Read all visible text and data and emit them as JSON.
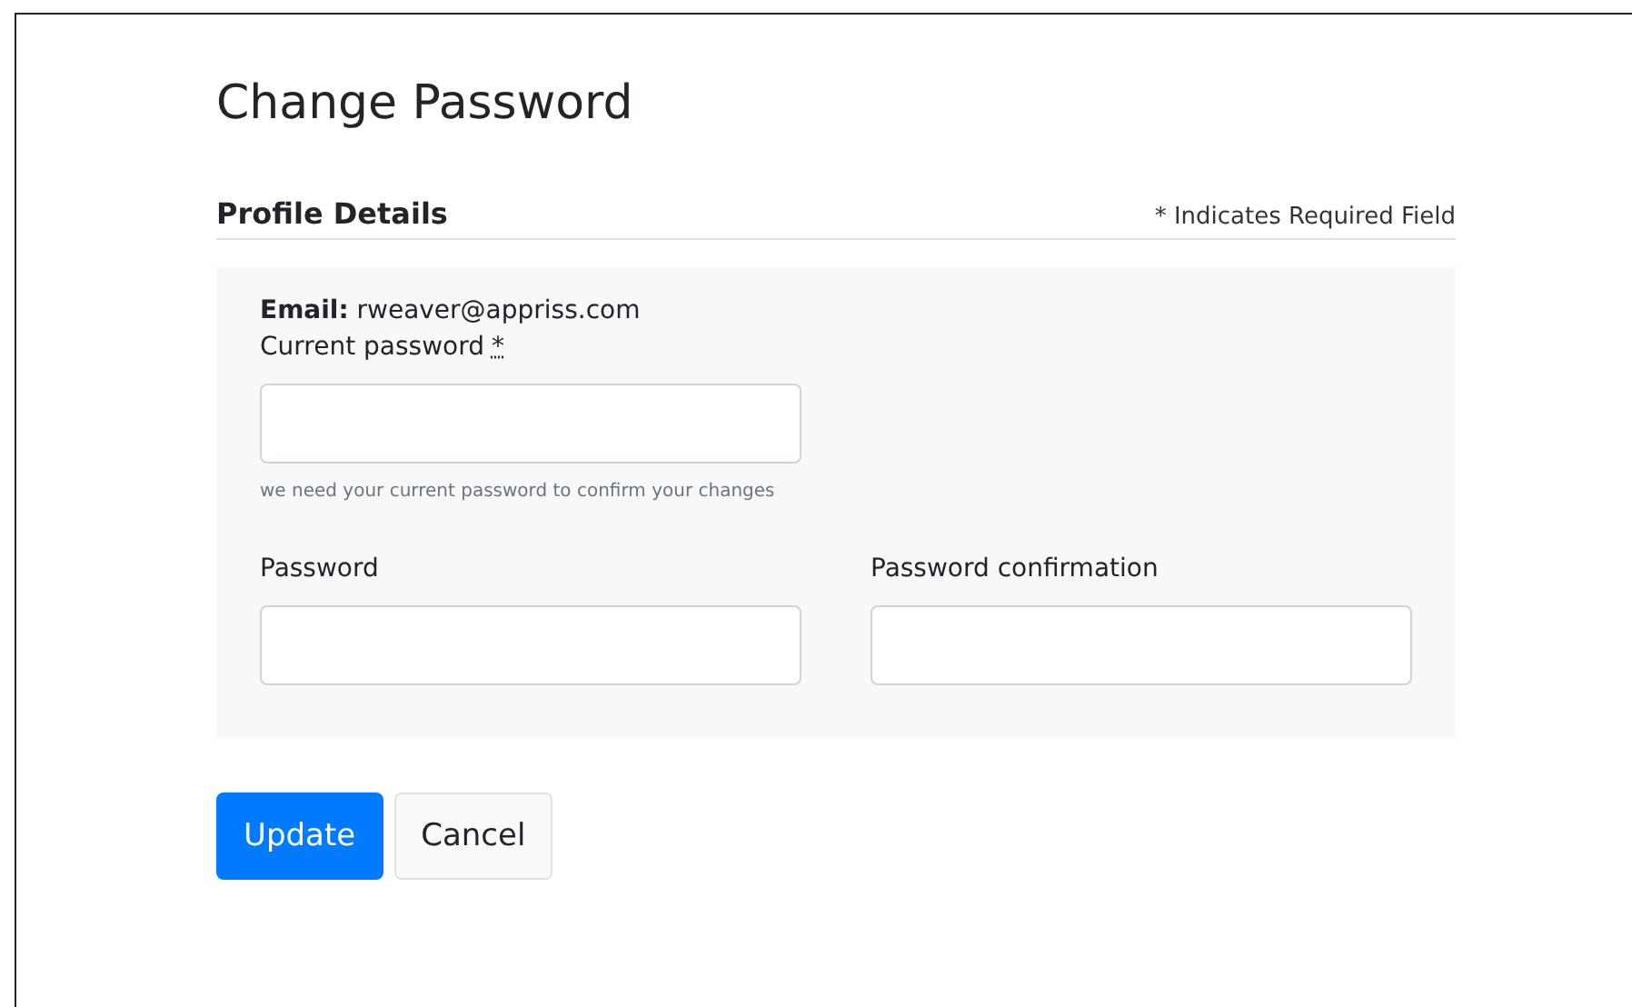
{
  "title": "Change Password",
  "section": {
    "heading": "Profile Details",
    "required_note": "* Indicates Required Field"
  },
  "email": "**Email:** rweaver@appriss.com",
  "current_password": {
    "label": "Current password",
    "required_mark": "*",
    "help": "we need your current password to confirm your changes"
  },
  "fields": [
    {
      "label": "Password"
    },
    {
      "label": "Password confirmation"
    }
  ],
  "buttons": [
    {
      "label": "Update",
      "kind": "primary"
    },
    {
      "label": "Cancel",
      "kind": "secondary"
    }
  ]
}
